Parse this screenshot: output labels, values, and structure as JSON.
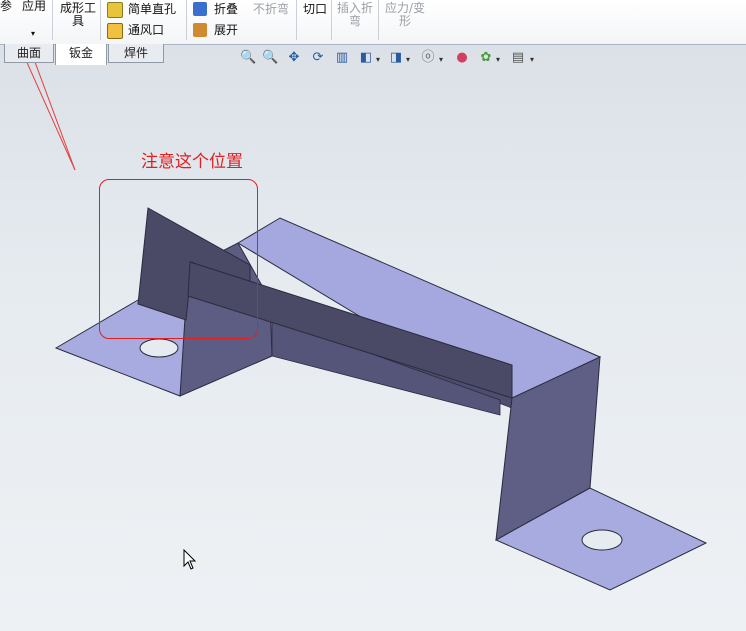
{
  "ribbon": {
    "partial_left": "参",
    "apply": "应用",
    "apply_arrow": "▾",
    "forming_tool": "成形工具",
    "simple_hole": "简单直孔",
    "vent": "通风口",
    "fold": "折叠",
    "unfold": "展开",
    "no_bend": "不折弯",
    "cut": "切口",
    "insert_bend": "插入折弯",
    "stress": "应力/变形"
  },
  "tabs": [
    {
      "label": "曲面",
      "active": false
    },
    {
      "label": "钣金",
      "active": true
    },
    {
      "label": "焊件",
      "active": false
    }
  ],
  "view_toolbar": {
    "zoom_to_fit": "🔍",
    "zoom_area": "🔍",
    "pan": "✥",
    "rotate": "⟳",
    "section": "▥",
    "view_orient": "◧",
    "display_style": "◨",
    "hide_show": "ⓞ",
    "appearance": "●",
    "scene": "✿",
    "render": "▤",
    "dropdown": "▾"
  },
  "annotation": {
    "text": "注意这个位置",
    "color": "#e02020"
  },
  "colors": {
    "sheet_top": "#a3a6dc",
    "sheet_side": "#5f5f86",
    "sheet_dark": "#4a4a66",
    "edge": "#2a2a40"
  }
}
